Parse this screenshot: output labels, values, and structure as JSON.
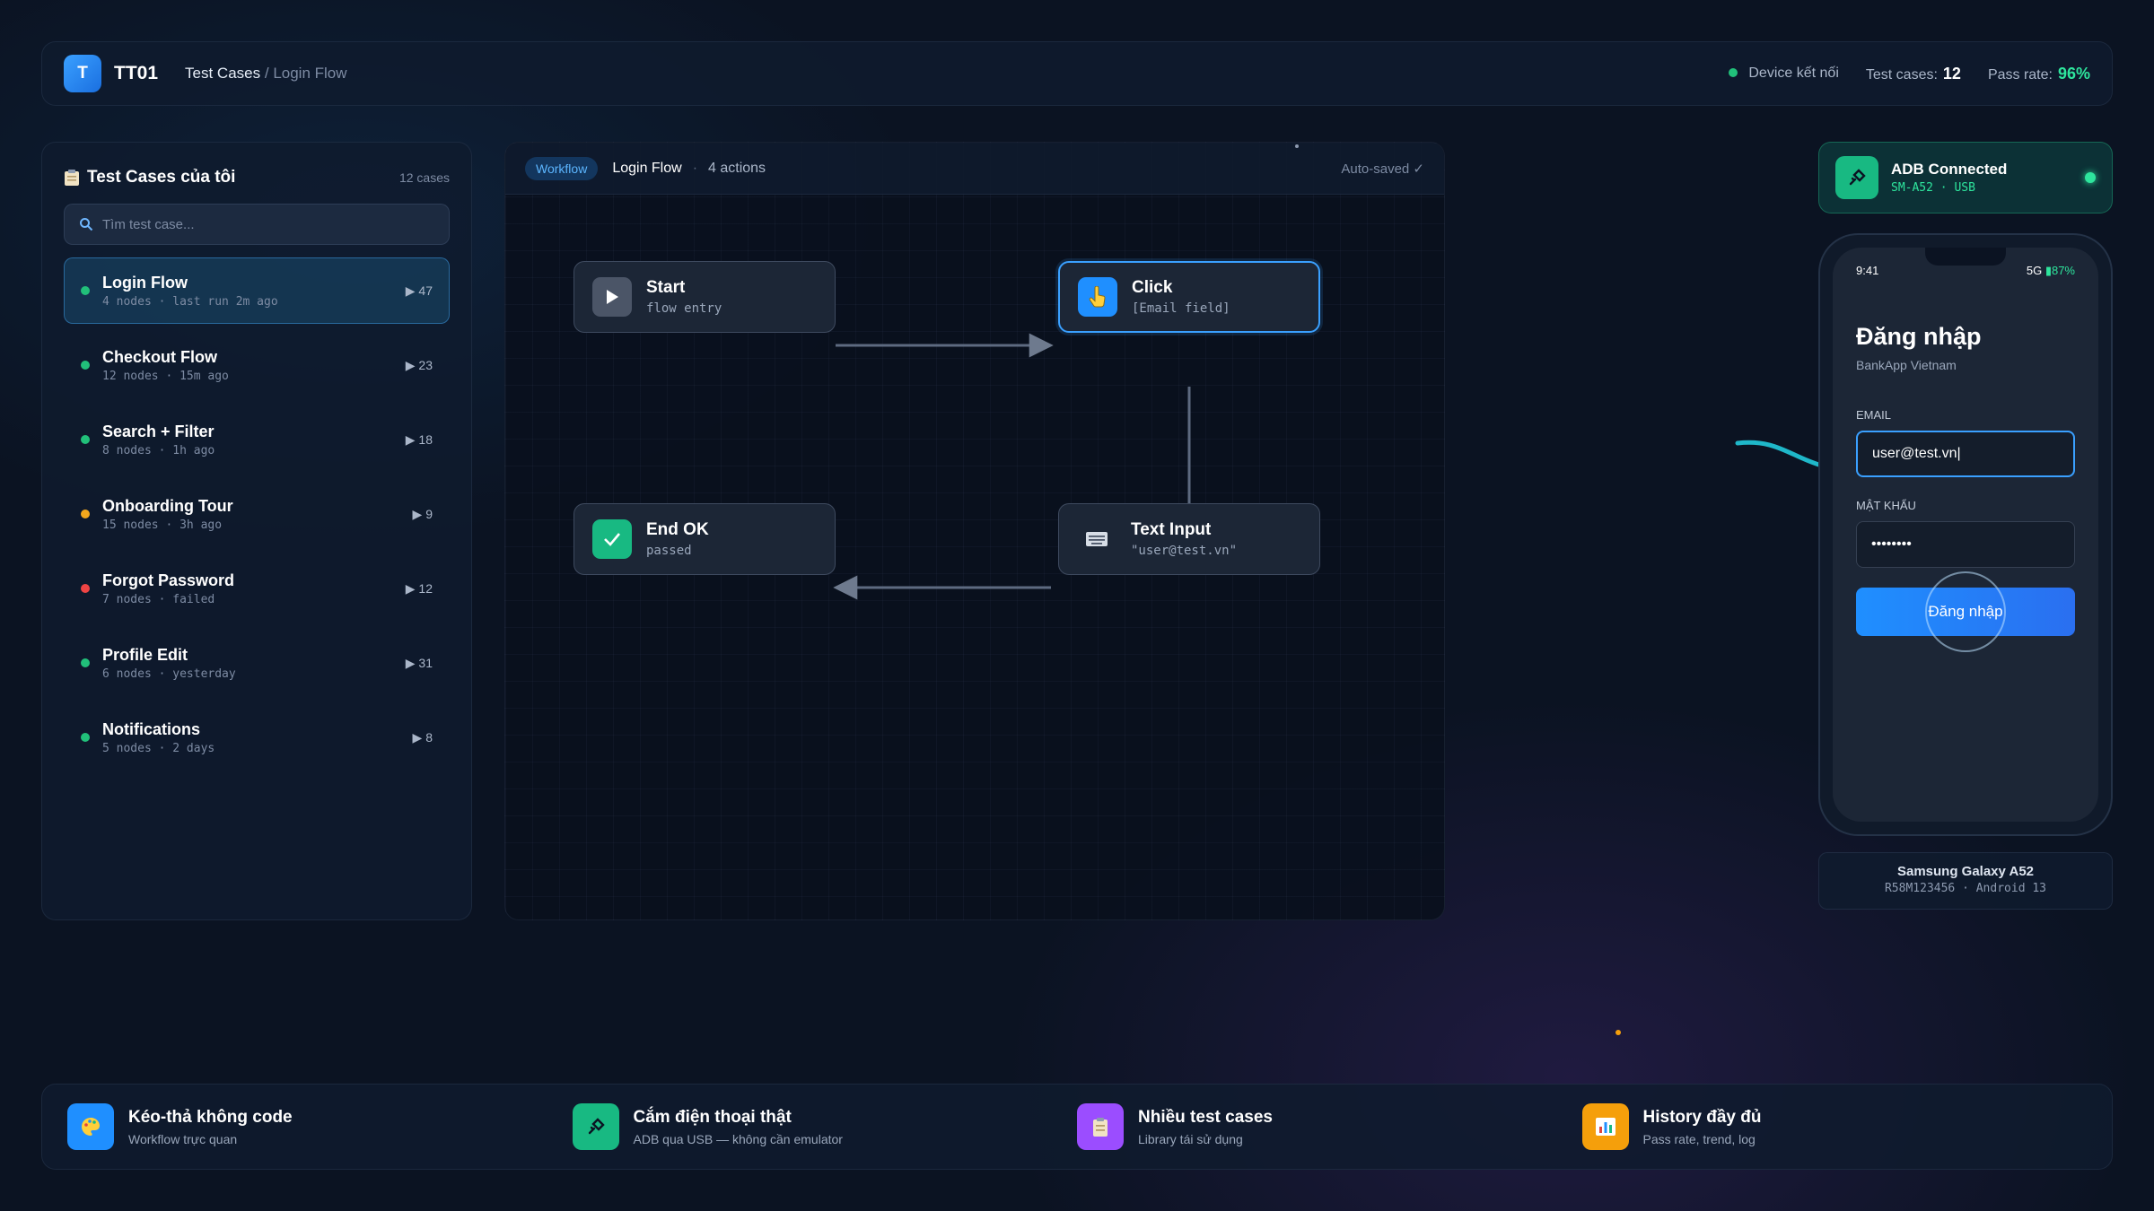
{
  "header": {
    "logo_letter": "T",
    "brand": "TT01",
    "crumb_main": "Test Cases",
    "crumb_sep": "/",
    "crumb_sub": "Login Flow",
    "device_status": "Device kết nối",
    "test_cases_label": "Test cases:",
    "test_cases_value": "12",
    "pass_rate_label": "Pass rate:",
    "pass_rate_value": "96%"
  },
  "sidebar": {
    "title": "Test Cases của tôi",
    "title_icon": "clipboard-icon",
    "count": "12 cases",
    "search_placeholder": "Tìm test case...",
    "items": [
      {
        "name": "Login Flow",
        "meta": "4 nodes · last run 2m ago",
        "runs": "▶ 47",
        "status": "#21c07a",
        "active": true
      },
      {
        "name": "Checkout Flow",
        "meta": "12 nodes · 15m ago",
        "runs": "▶ 23",
        "status": "#21c07a"
      },
      {
        "name": "Search + Filter",
        "meta": "8 nodes · 1h ago",
        "runs": "▶ 18",
        "status": "#21c07a"
      },
      {
        "name": "Onboarding Tour",
        "meta": "15 nodes · 3h ago",
        "runs": "▶ 9",
        "status": "#f4a81d"
      },
      {
        "name": "Forgot Password",
        "meta": "7 nodes · failed",
        "runs": "▶ 12",
        "status": "#ef4444"
      },
      {
        "name": "Profile Edit",
        "meta": "6 nodes · yesterday",
        "runs": "▶ 31",
        "status": "#21c07a"
      },
      {
        "name": "Notifications",
        "meta": "5 nodes · 2 days",
        "runs": "▶ 8",
        "status": "#21c07a"
      }
    ]
  },
  "canvas": {
    "pill": "Workflow",
    "flow_name": "Login Flow",
    "dot": "·",
    "actions": "4 actions",
    "autosave": "Auto-saved ✓",
    "nodes": {
      "start": {
        "title": "Start",
        "sub": "flow entry",
        "icon": "play-icon"
      },
      "click": {
        "title": "Click",
        "sub": "[Email field]",
        "icon": "pointer-hand-icon"
      },
      "end": {
        "title": "End OK",
        "sub": "passed",
        "icon": "check-icon"
      },
      "input": {
        "title": "Text Input",
        "sub": "\"user@test.vn\"",
        "icon": "keyboard-icon"
      }
    }
  },
  "adb": {
    "title": "ADB Connected",
    "sub": "SM-A52 · USB",
    "icon": "usb-plug-icon"
  },
  "phone": {
    "time": "9:41",
    "network": "5G",
    "battery": "▮87%",
    "title": "Đăng nhập",
    "subtitle": "BankApp Vietnam",
    "email_label": "EMAIL",
    "email_value": "user@test.vn",
    "password_label": "MẬT KHẨU",
    "password_value": "••••••••",
    "login_button": "Đăng nhập"
  },
  "device": {
    "name": "Samsung Galaxy A52",
    "sub": "R58M123456 · Android 13"
  },
  "features": [
    {
      "title": "Kéo-thả không code",
      "sub": "Workflow trực quan",
      "icon": "palette-icon",
      "color": "#1f8fff"
    },
    {
      "title": "Cắm điện thoại thật",
      "sub": "ADB qua USB — không cần emulator",
      "icon": "usb-plug-icon",
      "color": "#18b982"
    },
    {
      "title": "Nhiều test cases",
      "sub": "Library tái sử dụng",
      "icon": "clipboard-icon",
      "color": "#9b4dff"
    },
    {
      "title": "History đầy đủ",
      "sub": "Pass rate, trend, log",
      "icon": "bar-chart-icon",
      "color": "#f59f0b"
    }
  ],
  "colors": {
    "accent": "#3aa0ff",
    "success": "#2ee59d",
    "warning": "#f4a81d",
    "danger": "#ef4444"
  }
}
